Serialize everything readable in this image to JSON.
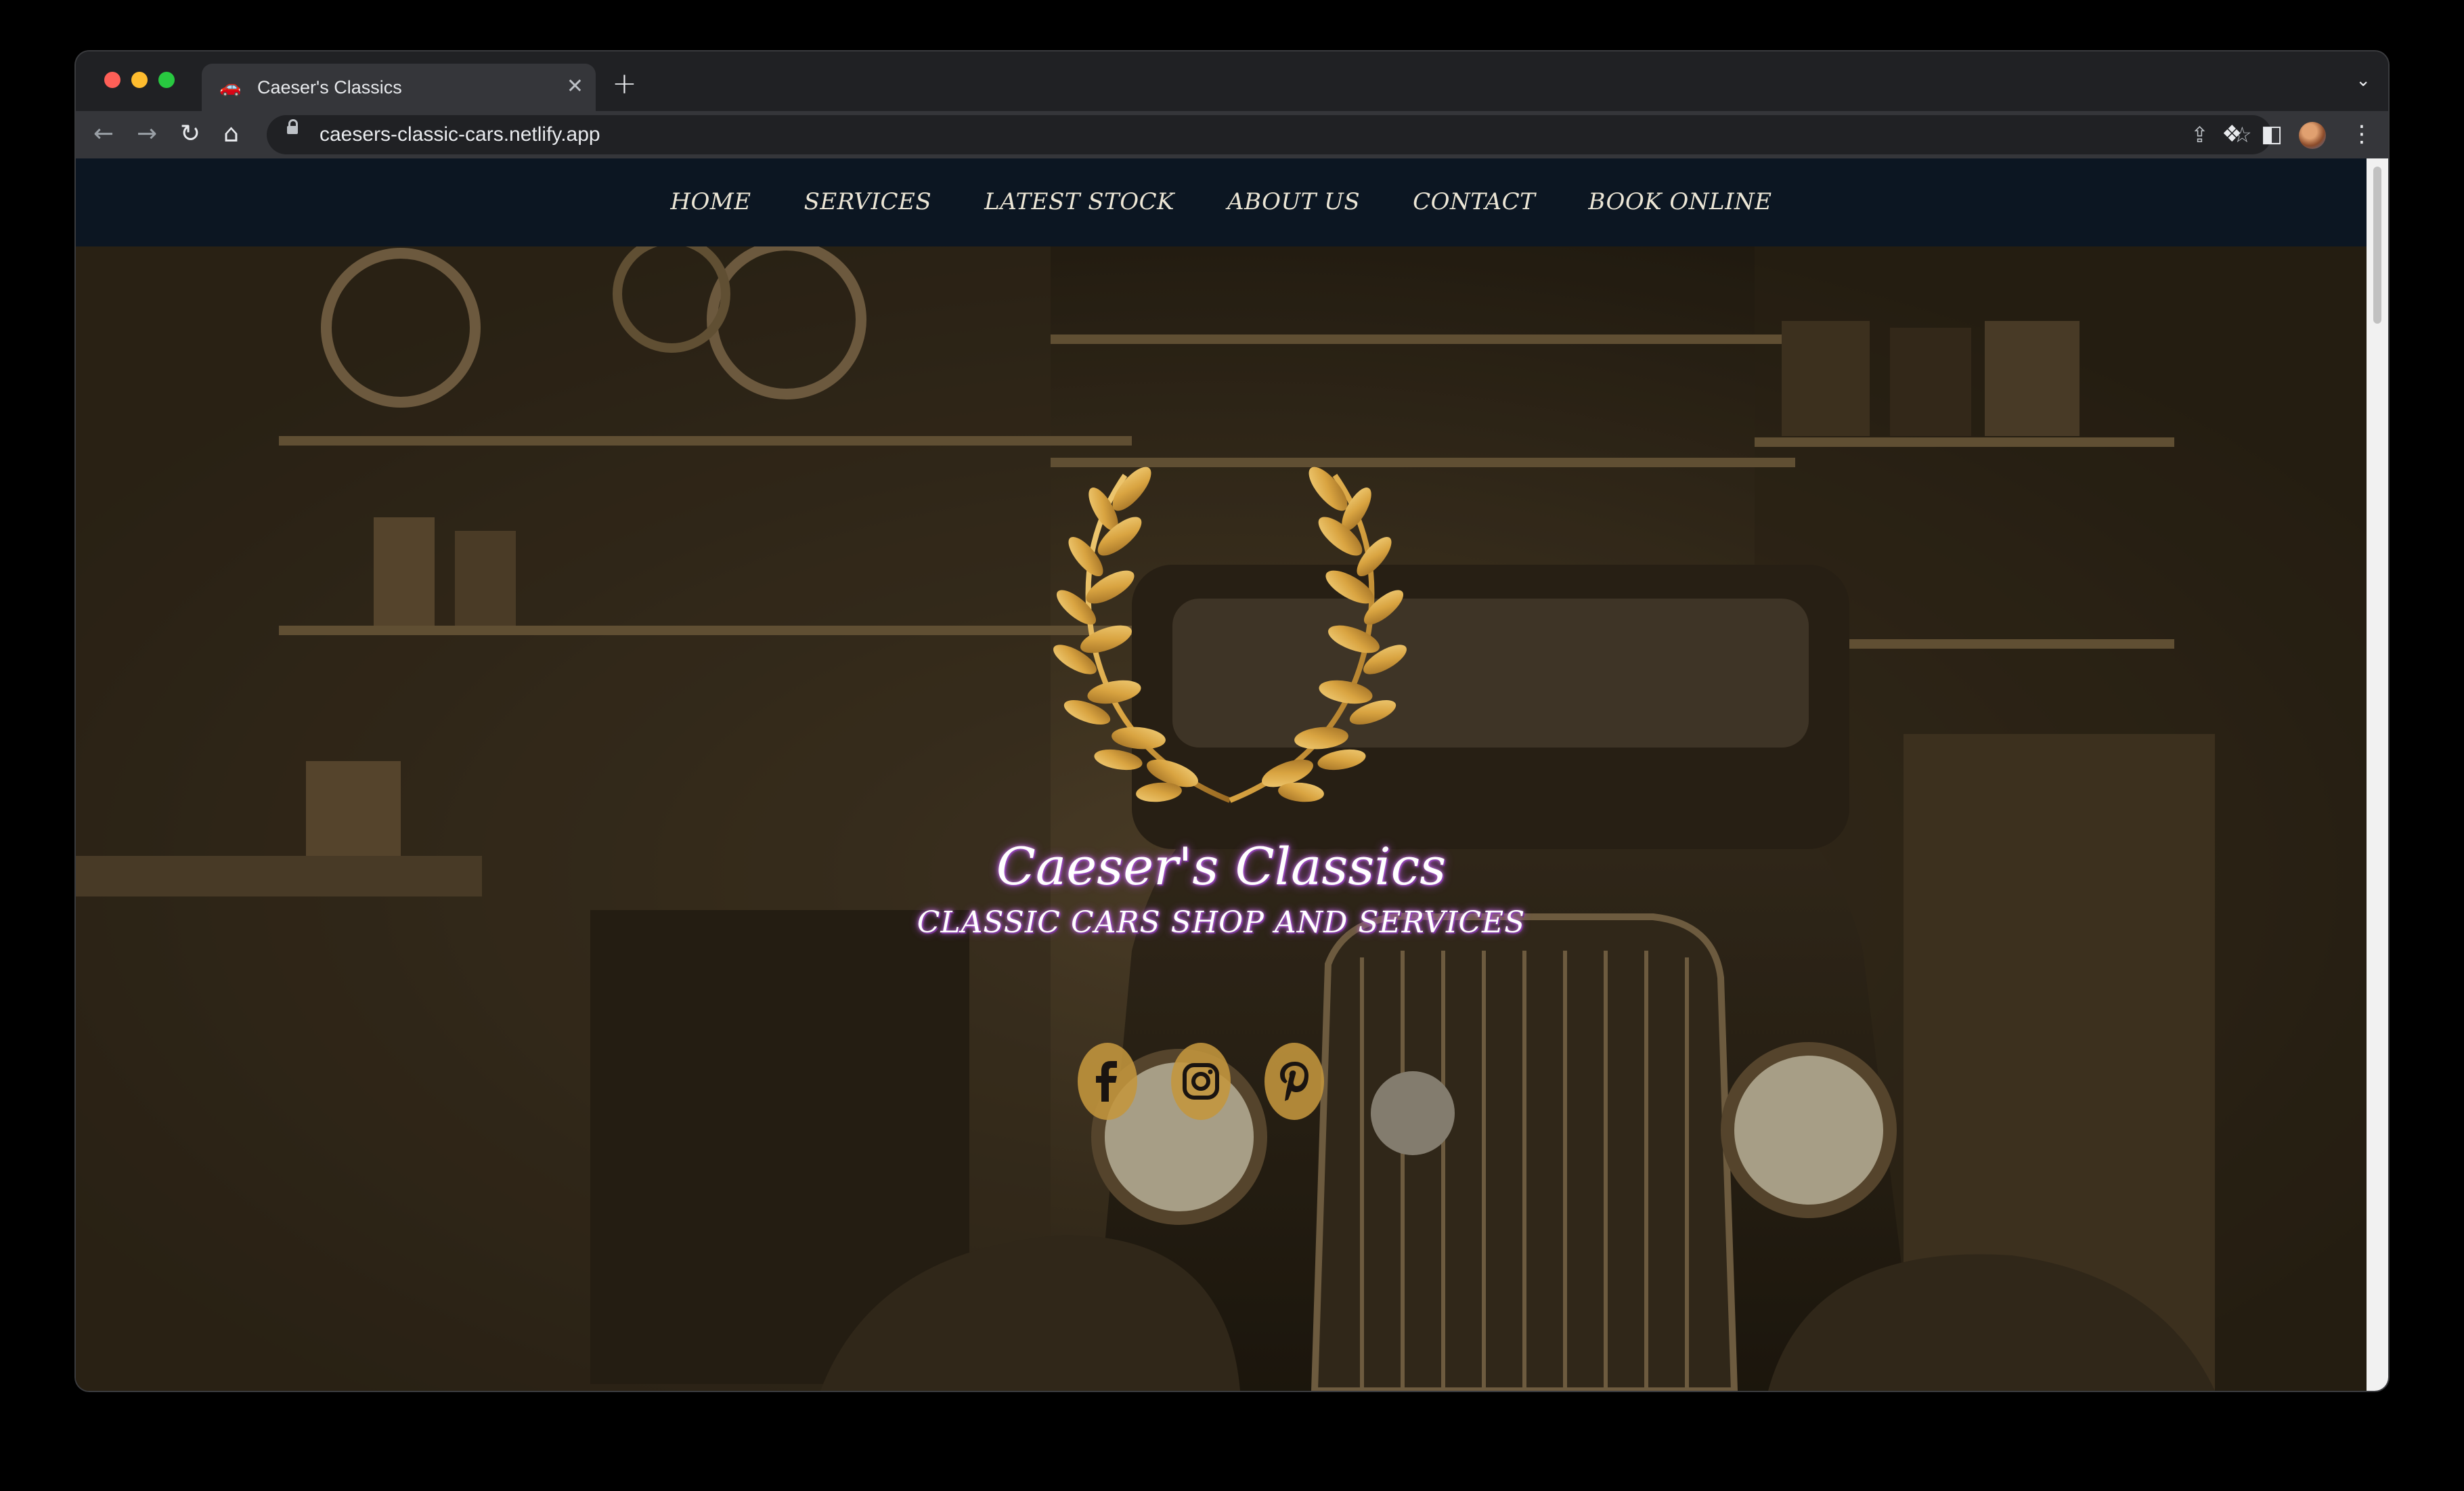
{
  "browser": {
    "tab": {
      "favicon": "car-icon",
      "title": "Caeser's Classics"
    },
    "url": "caesers-classic-cars.netlify.app"
  },
  "site": {
    "nav": [
      "HOME",
      "SERVICES",
      "LATEST STOCK",
      "ABOUT US",
      "CONTACT",
      "BOOK ONLINE"
    ],
    "hero": {
      "emblem": "laurel-wreath-icon",
      "title": "Caeser's Classics",
      "subtitle": "CLASSIC CARS SHOP AND SERVICES",
      "socials": [
        "facebook-icon",
        "instagram-icon",
        "pinterest-icon"
      ]
    }
  },
  "colors": {
    "nav_bg": "#0c1622",
    "social_bg": "#c4963e",
    "title_glow": "#a64bd8",
    "wreath_gold": "#d9a441"
  }
}
